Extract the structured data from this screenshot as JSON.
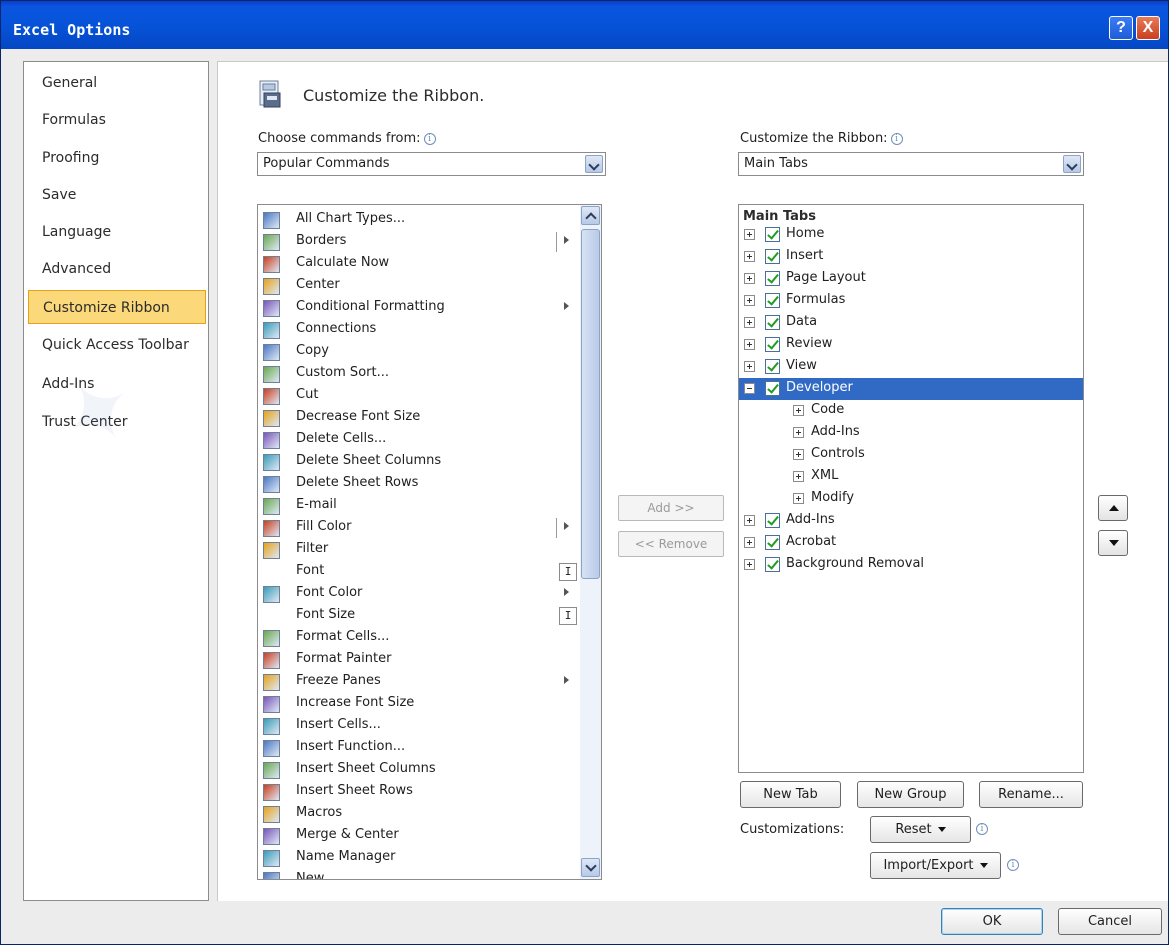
{
  "window": {
    "title": "Excel Options",
    "help_glyph": "?",
    "close_glyph": "X"
  },
  "sidebar": {
    "items": [
      {
        "label": "General"
      },
      {
        "label": "Formulas"
      },
      {
        "label": "Proofing"
      },
      {
        "label": "Save"
      },
      {
        "label": "Language"
      },
      {
        "label": "Advanced"
      },
      {
        "label": "Customize Ribbon",
        "active": true
      },
      {
        "label": "Quick Access Toolbar"
      },
      {
        "label": "Add-Ins"
      },
      {
        "label": "Trust Center"
      }
    ]
  },
  "main": {
    "header_title": "Customize the Ribbon.",
    "header_icon": "ribbon-customize-icon",
    "choose_label": "Choose commands from:",
    "choose_value": "Popular Commands",
    "ribbon_label": "Customize the Ribbon:",
    "ribbon_value": "Main Tabs",
    "info_glyph": "i"
  },
  "commands": [
    {
      "label": "All Chart Types...",
      "icon": "chart-types-icon"
    },
    {
      "label": "Borders",
      "icon": "borders-icon",
      "split": true
    },
    {
      "label": "Calculate Now",
      "icon": "calculator-icon"
    },
    {
      "label": "Center",
      "icon": "align-center-icon"
    },
    {
      "label": "Conditional Formatting",
      "icon": "conditional-formatting-icon",
      "submenu": true
    },
    {
      "label": "Connections",
      "icon": "connections-icon"
    },
    {
      "label": "Copy",
      "icon": "copy-icon"
    },
    {
      "label": "Custom Sort...",
      "icon": "sort-icon"
    },
    {
      "label": "Cut",
      "icon": "scissors-icon"
    },
    {
      "label": "Decrease Font Size",
      "icon": "decrease-font-icon"
    },
    {
      "label": "Delete Cells...",
      "icon": "delete-cells-icon"
    },
    {
      "label": "Delete Sheet Columns",
      "icon": "delete-columns-icon"
    },
    {
      "label": "Delete Sheet Rows",
      "icon": "delete-rows-icon"
    },
    {
      "label": "E-mail",
      "icon": "email-icon"
    },
    {
      "label": "Fill Color",
      "icon": "fill-color-icon",
      "split": true
    },
    {
      "label": "Filter",
      "icon": "filter-icon"
    },
    {
      "label": "Font",
      "icon": "",
      "ibeam": true
    },
    {
      "label": "Font Color",
      "icon": "font-color-icon",
      "submenu": true
    },
    {
      "label": "Font Size",
      "icon": "",
      "ibeam": true
    },
    {
      "label": "Format Cells...",
      "icon": "format-cells-icon"
    },
    {
      "label": "Format Painter",
      "icon": "format-painter-icon"
    },
    {
      "label": "Freeze Panes",
      "icon": "freeze-panes-icon",
      "submenu": true
    },
    {
      "label": "Increase Font Size",
      "icon": "increase-font-icon"
    },
    {
      "label": "Insert Cells...",
      "icon": "insert-cells-icon"
    },
    {
      "label": "Insert Function...",
      "icon": "function-icon"
    },
    {
      "label": "Insert Sheet Columns",
      "icon": "insert-columns-icon"
    },
    {
      "label": "Insert Sheet Rows",
      "icon": "insert-rows-icon"
    },
    {
      "label": "Macros",
      "icon": "macros-icon"
    },
    {
      "label": "Merge & Center",
      "icon": "merge-center-icon"
    },
    {
      "label": "Name Manager",
      "icon": "name-manager-icon"
    },
    {
      "label": "New",
      "icon": "new-document-icon"
    }
  ],
  "transfer": {
    "add_label": "Add >>",
    "remove_label": "<< Remove"
  },
  "tabs_tree": {
    "header": "Main Tabs",
    "items": [
      {
        "label": "Home",
        "level": 0,
        "checkbox": true,
        "expanded": false
      },
      {
        "label": "Insert",
        "level": 0,
        "checkbox": true,
        "expanded": false
      },
      {
        "label": "Page Layout",
        "level": 0,
        "checkbox": true,
        "expanded": false
      },
      {
        "label": "Formulas",
        "level": 0,
        "checkbox": true,
        "expanded": false
      },
      {
        "label": "Data",
        "level": 0,
        "checkbox": true,
        "expanded": false
      },
      {
        "label": "Review",
        "level": 0,
        "checkbox": true,
        "expanded": false
      },
      {
        "label": "View",
        "level": 0,
        "checkbox": true,
        "expanded": false
      },
      {
        "label": "Developer",
        "level": 0,
        "checkbox": true,
        "expanded": true,
        "selected": true
      },
      {
        "label": "Code",
        "level": 1,
        "checkbox": false,
        "expanded": false
      },
      {
        "label": "Add-Ins",
        "level": 1,
        "checkbox": false,
        "expanded": false
      },
      {
        "label": "Controls",
        "level": 1,
        "checkbox": false,
        "expanded": false
      },
      {
        "label": "XML",
        "level": 1,
        "checkbox": false,
        "expanded": false
      },
      {
        "label": "Modify",
        "level": 1,
        "checkbox": false,
        "expanded": false
      },
      {
        "label": "Add-Ins",
        "level": 0,
        "checkbox": true,
        "expanded": false
      },
      {
        "label": "Acrobat",
        "level": 0,
        "checkbox": true,
        "expanded": false
      },
      {
        "label": "Background Removal",
        "level": 0,
        "checkbox": true,
        "expanded": false
      }
    ]
  },
  "tree_buttons": {
    "new_tab": "New Tab",
    "new_group": "New Group",
    "rename": "Rename...",
    "customizations_label": "Customizations:",
    "reset": "Reset",
    "import_export": "Import/Export"
  },
  "footer": {
    "ok": "OK",
    "cancel": "Cancel"
  }
}
